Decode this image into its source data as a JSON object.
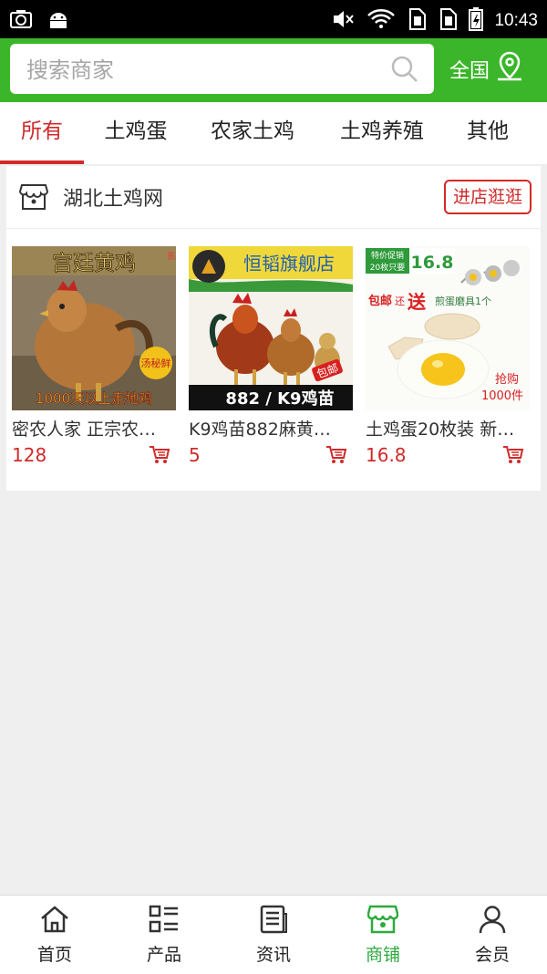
{
  "status_bar": {
    "time": "10:43",
    "icons": [
      "camera-icon",
      "android-icon",
      "mute-icon",
      "wifi-icon",
      "sim1-icon",
      "sim2-icon",
      "battery-icon"
    ]
  },
  "search": {
    "placeholder": "搜索商家",
    "region_label": "全国"
  },
  "tabs": [
    {
      "label": "所有",
      "active": true
    },
    {
      "label": "土鸡蛋"
    },
    {
      "label": "农家土鸡"
    },
    {
      "label": "土鸡养殖"
    },
    {
      "label": "其他"
    }
  ],
  "shop": {
    "name": "湖北土鸡网",
    "visit_label": "进店逛逛",
    "products": [
      {
        "name": "密农人家 正宗农…",
        "price": "128",
        "image_text": {
          "title": "宫廷黄鸡",
          "side": "贡品",
          "badge": "汤秘鲜",
          "bottom": "1000天以上走地鸡"
        }
      },
      {
        "name": "K9鸡苗882麻黄…",
        "price": "5",
        "image_text": {
          "title": "恒韬旗舰店",
          "tag": "包邮",
          "bottom": "882 / K9鸡苗"
        }
      },
      {
        "name": "土鸡蛋20枚装 新…",
        "price": "16.8",
        "image_text": {
          "promo1": "特价促销",
          "promo2": "20枚只要",
          "price": "16.8",
          "gift1": "包邮",
          "gift2": "还",
          "gift3": "送",
          "gift4": "煎蛋磨具1个",
          "rush1": "抢购",
          "rush2": "1000件"
        }
      }
    ]
  },
  "bottom_nav": [
    {
      "label": "首页",
      "icon": "home-icon"
    },
    {
      "label": "产品",
      "icon": "product-list-icon"
    },
    {
      "label": "资讯",
      "icon": "news-icon"
    },
    {
      "label": "商铺",
      "icon": "store-icon",
      "active": true
    },
    {
      "label": "会员",
      "icon": "member-icon"
    }
  ],
  "colors": {
    "header_green": "#3bb62a",
    "accent_red": "#d02a2a",
    "nav_active_green": "#2eaa3e"
  }
}
